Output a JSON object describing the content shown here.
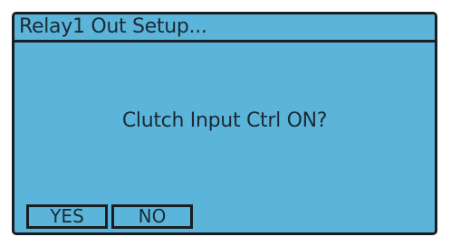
{
  "dialog": {
    "title": "Relay1 Out Setup...",
    "prompt": "Clutch Input Ctrl ON?",
    "buttons": {
      "yes_label": "YES",
      "no_label": "NO"
    }
  },
  "colors": {
    "screen_background": "#5bb4da",
    "border": "#1a1d22",
    "text": "#1d2a33"
  }
}
